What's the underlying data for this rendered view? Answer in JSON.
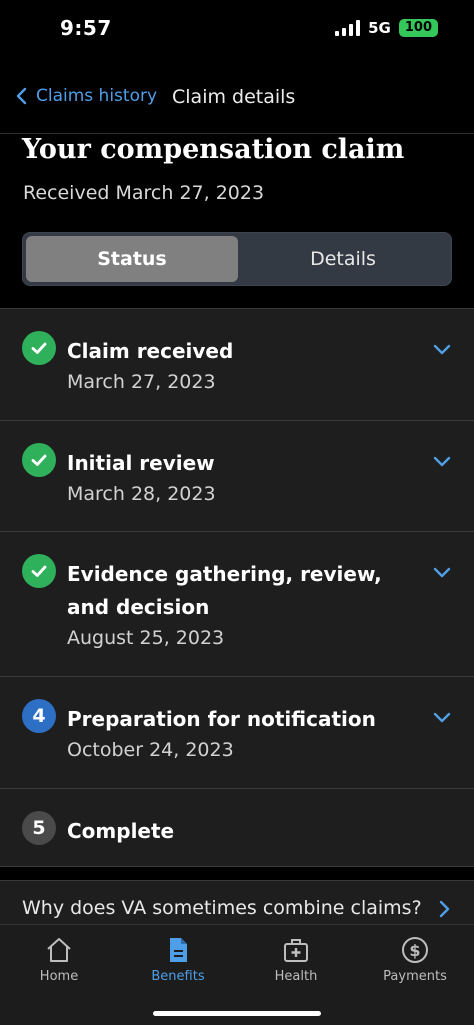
{
  "status_bar": {
    "time": "9:57",
    "network": "5G",
    "battery": "100"
  },
  "header": {
    "back_label": "Claims history",
    "title": "Claim details"
  },
  "claim": {
    "title": "Your compensation claim",
    "received": "Received March 27, 2023"
  },
  "segments": {
    "status": "Status",
    "details": "Details",
    "selected": "Status"
  },
  "steps": [
    {
      "number": "1",
      "state": "complete",
      "title": "Claim received",
      "date": "March 27, 2023"
    },
    {
      "number": "2",
      "state": "complete",
      "title": "Initial review",
      "date": "March 28, 2023"
    },
    {
      "number": "3",
      "state": "complete",
      "title": "Evidence gathering, review, and decision",
      "date": "August 25, 2023"
    },
    {
      "number": "4",
      "state": "current",
      "title": "Preparation for notification",
      "date": "October 24, 2023"
    },
    {
      "number": "5",
      "state": "future",
      "title": "Complete",
      "date": ""
    }
  ],
  "combine_link": "Why does VA sometimes combine claims?",
  "tabs": [
    {
      "label": "Home",
      "icon": "home-icon",
      "active": false
    },
    {
      "label": "Benefits",
      "icon": "document-icon",
      "active": true
    },
    {
      "label": "Health",
      "icon": "medical-bag-icon",
      "active": false
    },
    {
      "label": "Payments",
      "icon": "dollar-icon",
      "active": false
    }
  ],
  "colors": {
    "accent": "#4f9fe8",
    "success": "#2fb05a",
    "current": "#2d6fc4"
  }
}
